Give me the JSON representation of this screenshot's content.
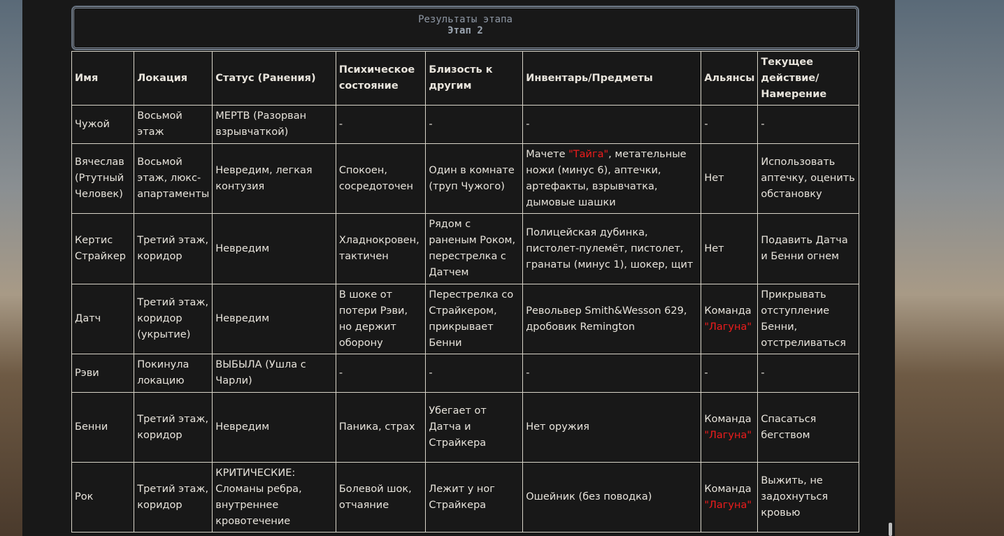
{
  "header": {
    "title": "Результаты этапа",
    "subtitle": "Этап 2"
  },
  "columns": [
    "Имя",
    "Локация",
    "Статус (Ранения)",
    "Психическое состояние",
    "Близость к другим",
    "Инвентарь/Предметы",
    "Альянсы",
    "Текущее действие/ Намерение"
  ],
  "rows": [
    [
      [
        {
          "t": "Чужой"
        }
      ],
      [
        {
          "t": "Восьмой этаж"
        }
      ],
      [
        {
          "t": "МЕРТВ (Разорван взрывчаткой)"
        }
      ],
      [
        {
          "t": "-"
        }
      ],
      [
        {
          "t": "-"
        }
      ],
      [
        {
          "t": "-"
        }
      ],
      [
        {
          "t": "-"
        }
      ],
      [
        {
          "t": "-"
        }
      ]
    ],
    [
      [
        {
          "t": "Вячеслав (Ртутный Человек)"
        }
      ],
      [
        {
          "t": "Восьмой этаж, люкс-апартаменты"
        }
      ],
      [
        {
          "t": "Невредим, легкая контузия"
        }
      ],
      [
        {
          "t": "Спокоен, сосредоточен"
        }
      ],
      [
        {
          "t": "Один в комнате (труп Чужого)"
        }
      ],
      [
        {
          "t": "Мачете "
        },
        {
          "t": "\"Тайга\"",
          "red": true
        },
        {
          "t": ", метательные ножи (минус 6), аптечки, артефакты, взрывчатка, дымовые шашки"
        }
      ],
      [
        {
          "t": "Нет"
        }
      ],
      [
        {
          "t": "Использовать аптечку, оценить обстановку"
        }
      ]
    ],
    [
      [
        {
          "t": "Кертис Страйкер"
        }
      ],
      [
        {
          "t": "Третий этаж, коридор"
        }
      ],
      [
        {
          "t": "Невредим"
        }
      ],
      [
        {
          "t": "Хладнокровен, тактичен"
        }
      ],
      [
        {
          "t": "Рядом с раненым Роком, перестрелка с Датчем"
        }
      ],
      [
        {
          "t": "Полицейская дубинка, пистолет-пулемёт, пистолет, гранаты (минус 1), шокер, щит"
        }
      ],
      [
        {
          "t": "Нет"
        }
      ],
      [
        {
          "t": "Подавить Датча и Бенни огнем"
        }
      ]
    ],
    [
      [
        {
          "t": "Датч"
        }
      ],
      [
        {
          "t": "Третий этаж, коридор (укрытие)"
        }
      ],
      [
        {
          "t": "Невредим"
        }
      ],
      [
        {
          "t": "В шоке от потери Рэви, но держит оборону"
        }
      ],
      [
        {
          "t": "Перестрелка со Страйкером, прикрывает Бенни"
        }
      ],
      [
        {
          "t": "Револьвер Smith&Wesson 629, дробовик Remington"
        }
      ],
      [
        {
          "t": "Команда "
        },
        {
          "t": "\"Лагуна\"",
          "red": true
        }
      ],
      [
        {
          "t": "Прикрывать отступление Бенни, отстреливаться"
        }
      ]
    ],
    [
      [
        {
          "t": "Рэви"
        }
      ],
      [
        {
          "t": "Покинула локацию"
        }
      ],
      [
        {
          "t": "ВЫБЫЛА (Ушла с Чарли)"
        }
      ],
      [
        {
          "t": "-"
        }
      ],
      [
        {
          "t": "-"
        }
      ],
      [
        {
          "t": "-"
        }
      ],
      [
        {
          "t": "-"
        }
      ],
      [
        {
          "t": "-"
        }
      ]
    ],
    [
      [
        {
          "t": "Бенни"
        }
      ],
      [
        {
          "t": "Третий этаж, коридор"
        }
      ],
      [
        {
          "t": "Невредим"
        }
      ],
      [
        {
          "t": "Паника, страх"
        }
      ],
      [
        {
          "t": "Убегает от Датча и Страйкера"
        }
      ],
      [
        {
          "t": "Нет оружия"
        }
      ],
      [
        {
          "t": "Команда "
        },
        {
          "t": "\"Лагуна\"",
          "red": true
        }
      ],
      [
        {
          "t": "Спасаться бегством"
        }
      ]
    ],
    [
      [
        {
          "t": "Рок"
        }
      ],
      [
        {
          "t": "Третий этаж, коридор"
        }
      ],
      [
        {
          "t": "КРИТИЧЕСКИЕ: Сломаны ребра, внутреннее кровотечение"
        }
      ],
      [
        {
          "t": "Болевой шок, отчаяние"
        }
      ],
      [
        {
          "t": "Лежит у ног Страйкера"
        }
      ],
      [
        {
          "t": "Ошейник (без поводка)"
        }
      ],
      [
        {
          "t": "Команда "
        },
        {
          "t": "\"Лагуна\"",
          "red": true
        }
      ],
      [
        {
          "t": "Выжить, не задохнуться кровью"
        }
      ]
    ]
  ]
}
